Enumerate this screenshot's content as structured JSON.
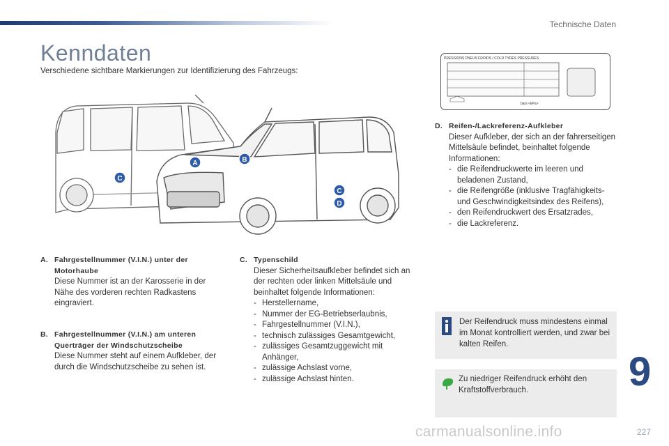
{
  "header": {
    "section_label": "Technische Daten"
  },
  "title": "Kenndaten",
  "subtitle": "Verschiedene sichtbare Markierungen zur Identifizierung des Fahrzeugs:",
  "figure": {
    "markers": [
      "A",
      "B",
      "C",
      "C",
      "D"
    ],
    "tyre_label": {
      "header": "PRESSIONS PNEUS FROIDS / COLD TYRES PRESSURES",
      "unit": "bars   <kPa>"
    }
  },
  "items": {
    "a": {
      "letter": "A.",
      "title": "Fahrgestellnummer (V.I.N.) unter der Motorhaube",
      "body": "Diese Nummer ist an der Karosserie in der Nähe des vorderen rechten Radkastens eingraviert."
    },
    "b": {
      "letter": "B.",
      "title": "Fahrgestellnummer (V.I.N.) am unteren Querträger der Windschutzscheibe",
      "body": "Diese Nummer steht auf einem Aufkleber, der durch die Windschutzscheibe zu sehen ist."
    },
    "c": {
      "letter": "C.",
      "title": "Typenschild",
      "body": "Dieser Sicherheitsaufkleber befindet sich an der rechten oder linken Mittelsäule und beinhaltet folgende Informationen:",
      "list": [
        "Herstellername,",
        "Nummer der EG-Betriebserlaubnis,",
        "Fahrgestellnummer (V.I.N.),",
        "technisch zulässiges Gesamtgewicht,",
        "zulässiges Gesamtzuggewicht mit Anhänger,",
        "zulässige Achslast vorne,",
        "zulässige Achslast hinten."
      ]
    },
    "d": {
      "letter": "D.",
      "title": "Reifen-/Lackreferenz-Aufkleber",
      "body": "Dieser Aufkleber, der sich an der fahrerseitigen Mittelsäule befindet, beinhaltet folgende Informationen:",
      "list": [
        "die Reifendruckwerte im leeren und beladenen Zustand,",
        "die Reifengröße (inklusive Tragfähigkeits- und Geschwindigkeitsindex des Reifens),",
        "den Reifendruckwert des Ersatzrades,",
        "die Lackreferenz."
      ]
    }
  },
  "info_box": {
    "text": "Der Reifendruck muss mindestens einmal im Monat kontrolliert werden, und zwar bei kalten Reifen."
  },
  "eco_box": {
    "text": "Zu niedriger Reifendruck erhöht den Kraftstoffverbrauch."
  },
  "chapter_number": "9",
  "page_number": "227",
  "watermark": "carmanualsonline.info",
  "colors": {
    "accent": "#2b4a82",
    "box_bg": "#ececec",
    "eco_green": "#3aa845",
    "marker_blue": "#2f5aa8"
  }
}
